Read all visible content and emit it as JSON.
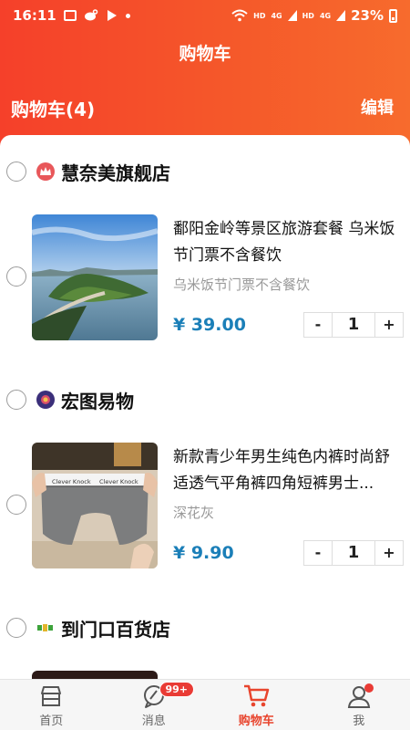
{
  "status_bar": {
    "time": "16:11",
    "battery": "23%",
    "net1": "HD",
    "net2": "4G",
    "net3": "HD",
    "net4": "4G"
  },
  "nav": {
    "title": "购物车"
  },
  "cart": {
    "count_label": "购物车(4)",
    "edit_label": "编辑"
  },
  "stores": [
    {
      "name": "慧奈美旗舰店",
      "items": [
        {
          "title": "鄱阳金岭等景区旅游套餐 乌米饭节门票不含餐饮",
          "spec": "乌米饭节门票不含餐饮",
          "price": "¥ 39.00",
          "qty": "1"
        }
      ]
    },
    {
      "name": "宏图易物",
      "items": [
        {
          "title": "新款青少年男生纯色内裤时尚舒适透气平角裤四角短裤男士...",
          "spec": "深花灰",
          "price": "¥ 9.90",
          "qty": "1"
        }
      ]
    },
    {
      "name": "到门口百货店",
      "items": []
    }
  ],
  "stepper": {
    "minus": "-",
    "plus": "+"
  },
  "thumb_texts": {
    "brand": "Clever Knock"
  },
  "tabbar": [
    {
      "label": "首页",
      "icon": "store-icon"
    },
    {
      "label": "消息",
      "icon": "chat-icon",
      "badge": "99+"
    },
    {
      "label": "购物车",
      "icon": "cart-icon",
      "active": true
    },
    {
      "label": "我",
      "icon": "user-icon"
    }
  ],
  "colors": {
    "header_start": "#f5402a",
    "header_end": "#f76b2d",
    "price": "#1b7fb8",
    "accent": "#e8452e"
  }
}
